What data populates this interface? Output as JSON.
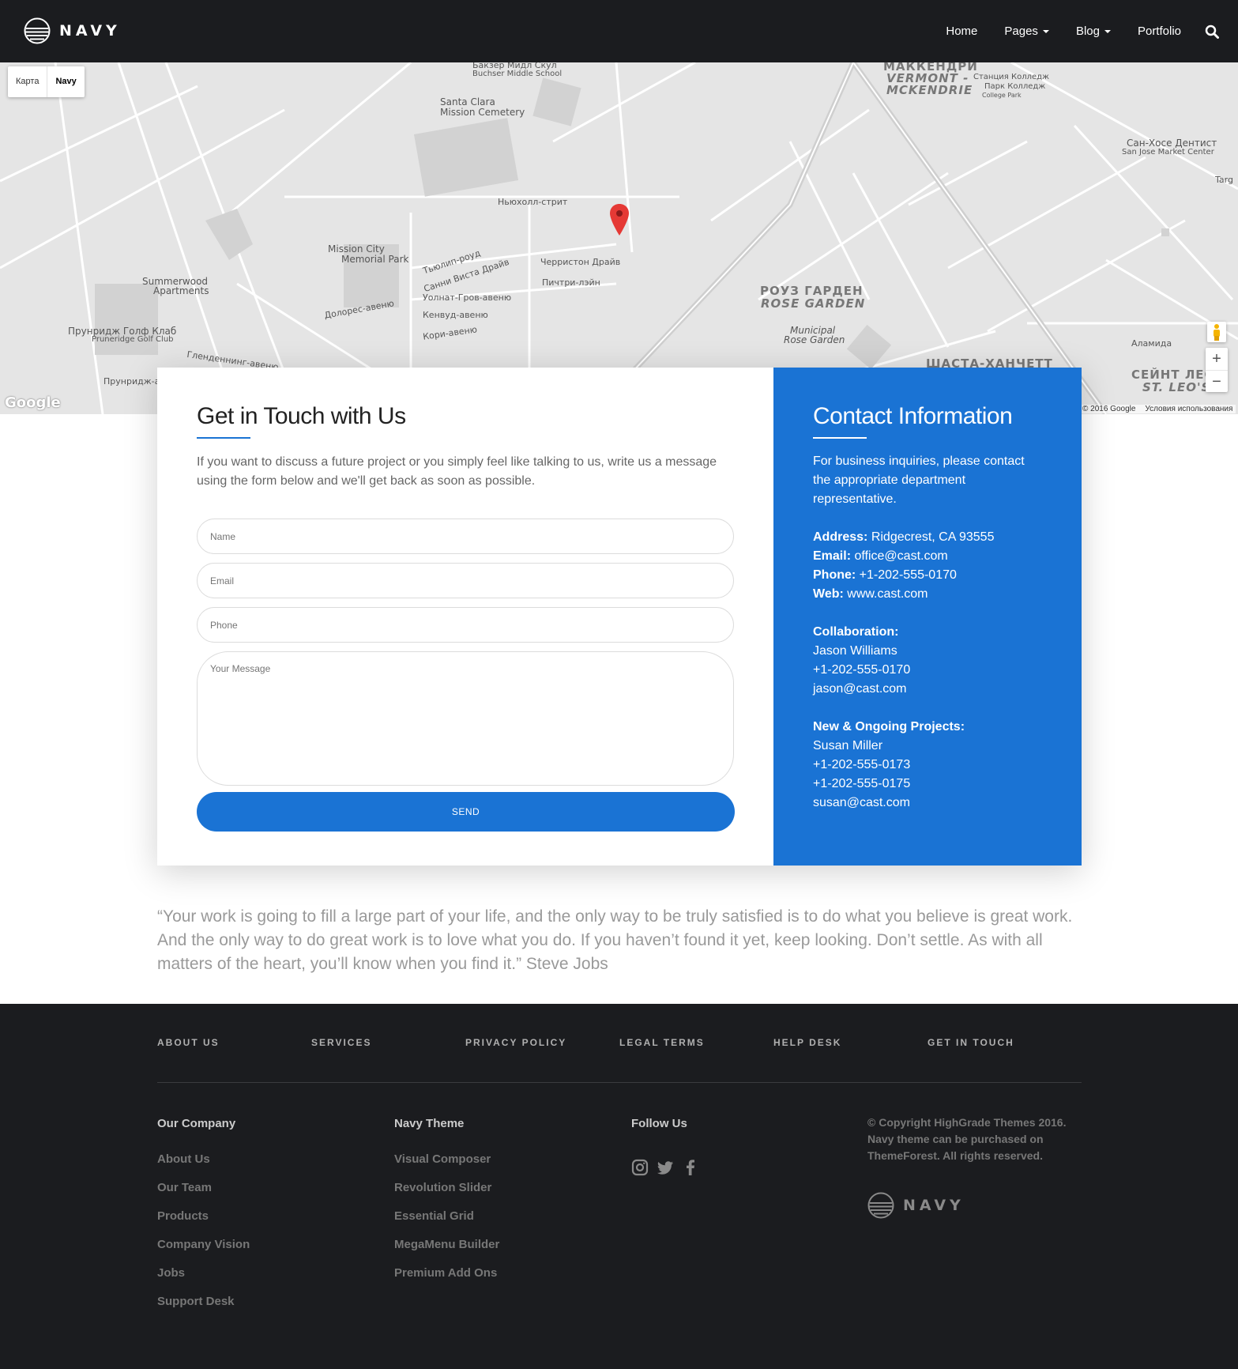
{
  "header": {
    "logo_text": "NAVY",
    "nav": [
      {
        "label": "Home",
        "has_dropdown": false
      },
      {
        "label": "Pages",
        "has_dropdown": true
      },
      {
        "label": "Blog",
        "has_dropdown": true
      },
      {
        "label": "Portfolio",
        "has_dropdown": false
      }
    ],
    "search_icon": "search-icon"
  },
  "map": {
    "type_toggle": [
      "Карта",
      "Navy"
    ],
    "active_type": "Navy",
    "labels": {
      "l1": "Бакзер Мидл Скул",
      "l2": "Buchser Middle School",
      "l3": "Santa Clara",
      "l4": "Mission Cemetery",
      "l5": "МАККЕНДРИ",
      "l6": "VERMONT -",
      "l7": "MCKENDRIE",
      "l8": "Станция Колледж",
      "l9": "Парк Колледж",
      "l10": "College Park",
      "l11": "Сан-Хосе Дентист",
      "l12": "San Jose Market Center",
      "l13": "Ньюхолл-стрит",
      "l14": "Mission City",
      "l15": "Memorial Park",
      "l16": "Summerwood",
      "l17": "Apartments",
      "l18": "Прунридж Голф Клаб",
      "l19": "Pruneridge Golf Club",
      "l20": "РОУЗ ГАРДЕН",
      "l21": "ROSE GARDEN",
      "l22": "Municipal",
      "l23": "Rose Garden",
      "l24": "Аламида",
      "l25": "ШАСТА-ХАНЧЕТТ",
      "l26": "СЕЙНТ ЛЕО",
      "l27": "ST. LEO'S",
      "l28": "Тьюлип-роуд",
      "l29": "Санни Виста Драйв",
      "l30": "Черристон Драйв",
      "l31": "Пичтри-лэйн",
      "l32": "Уолнат-Гров-авеню",
      "l33": "Кенвуд-авеню",
      "l34": "Кори-авеню",
      "l35": "Долорес-авеню",
      "l36": "Targ",
      "l37": "Прунридж-а",
      "l38": "Гленденнинг-авеню"
    },
    "zoom_in": "+",
    "zoom_out": "−",
    "google_logo": "Google",
    "copyright": "© 2016 Google",
    "terms": "Условия использования"
  },
  "contact_form": {
    "title": "Get in Touch with Us",
    "lead": "If you want to discuss a future project or you simply feel like talking to us, write us a message using the form below and we'll get back as soon as possible.",
    "name_placeholder": "Name",
    "email_placeholder": "Email",
    "phone_placeholder": "Phone",
    "message_placeholder": "Your Message",
    "send_label": "SEND"
  },
  "contact_info": {
    "title": "Contact Information",
    "intro": "For business inquiries, please contact the appropriate department representative.",
    "address_label": "Address:",
    "address": "Ridgecrest, CA 93555",
    "email_label": "Email:",
    "email": "office@cast.com",
    "phone_label": "Phone:",
    "phone": "+1-202-555-0170",
    "web_label": "Web:",
    "web": "www.cast.com",
    "collab_label": "Collaboration:",
    "collab_name": "Jason Williams",
    "collab_phone": "+1-202-555-0170",
    "collab_email": "jason@cast.com",
    "projects_label": "New & Ongoing Projects:",
    "projects_name": "Susan Miller",
    "projects_phone1": "+1-202-555-0173",
    "projects_phone2": "+1-202-555-0175",
    "projects_email": "susan@cast.com"
  },
  "quote": "“Your work is going to fill a large part of your life, and the only way to be truly satisfied is to do what you believe is great work. And the only way to do great work is to love what you do. If you haven’t found it yet, keep looking. Don’t settle. As with all matters of the heart, you’ll know when you find it.” Steve Jobs",
  "footer": {
    "top_links": [
      "ABOUT US",
      "SERVICES",
      "PRIVACY POLICY",
      "LEGAL TERMS",
      "HELP DESK",
      "GET IN TOUCH"
    ],
    "col1_title": "Our Company",
    "col1_items": [
      "About Us",
      "Our Team",
      "Products",
      "Company Vision",
      "Jobs",
      "Support Desk"
    ],
    "col2_title": "Navy Theme",
    "col2_items": [
      "Visual Composer",
      "Revolution Slider",
      "Essential Grid",
      "MegaMenu Builder",
      "Premium Add Ons"
    ],
    "col3_title": "Follow Us",
    "social_icons": [
      "instagram-icon",
      "twitter-icon",
      "facebook-icon"
    ],
    "copyright": "© Copyright HighGrade Themes 2016. Navy theme can be purchased on ThemeForest. All rights reserved.",
    "logo_text": "NAVY"
  },
  "colors": {
    "accent": "#1a73d4",
    "dark": "#1b1c1f",
    "map_bg": "#e5e5e5"
  }
}
